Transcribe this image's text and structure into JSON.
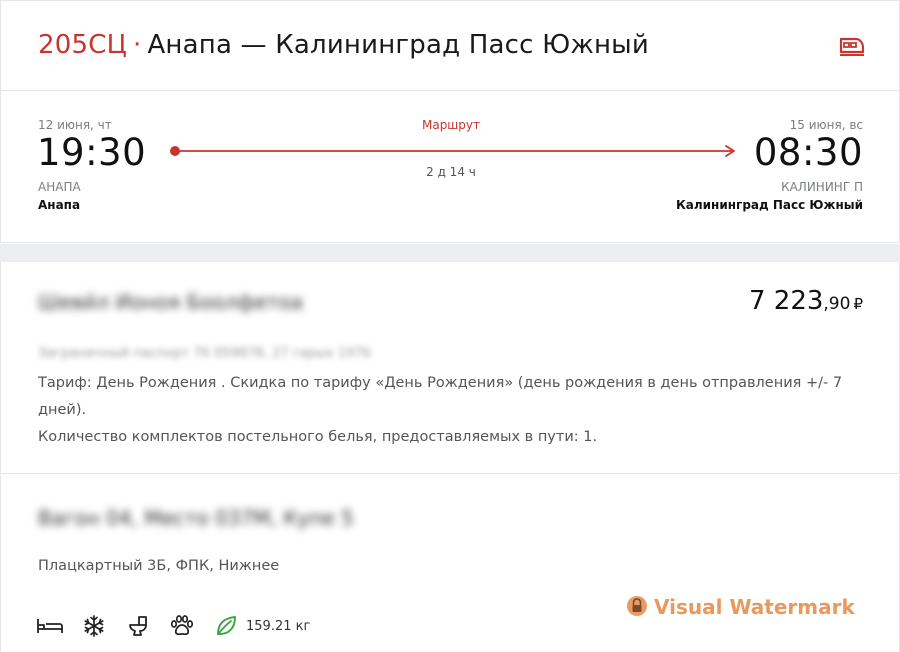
{
  "header": {
    "train_number": "205СЦ",
    "separator": "·",
    "route": "Анапа — Калининград Пасс Южный",
    "logo_icon": "train-icon"
  },
  "route": {
    "departure": {
      "date": "12 июня, чт",
      "time": "19:30",
      "station_code": "АНАПА",
      "station_name": "Анапа"
    },
    "arrival": {
      "date": "15 июня, вс",
      "time": "08:30",
      "station_code": "КАЛИНИНГ П",
      "station_name": "Калининград Пасс Южный"
    },
    "route_link": "Маршрут",
    "duration": "2 д 14 ч"
  },
  "passenger": {
    "name": "Шевйл Ионоя Боолфетоа",
    "document": "Заграничный паспорт 76 059878, 27 гарых 1976",
    "price_main": "7 223",
    "price_cents": ",90",
    "currency": "₽",
    "tariff": "Тариф: День Рождения . Скидка по тарифу «День Рождения» (день рождения в день отправления +/- 7 дней).",
    "bedding": "Количество комплектов постельного белья, предоставляемых в пути: 1."
  },
  "seat": {
    "car_seat": "Вагон 04, Место 037М, Купе 5",
    "car_type": "Плацкартный 3Б, ФПК, Нижнее",
    "amenity_icons": [
      "bed-icon",
      "snowflake-icon",
      "toilet-icon",
      "pet-paw-icon"
    ],
    "eco_icon": "leaf-icon",
    "co2_weight": "159.21 кг"
  },
  "watermark": {
    "text": "Visual Watermark",
    "icon": "lock-icon"
  },
  "colors": {
    "accent": "#c8352e",
    "text_gray": "#7a7d82",
    "band": "#eceef1",
    "eco_green": "#3aa64a",
    "watermark": "#e8914f"
  }
}
